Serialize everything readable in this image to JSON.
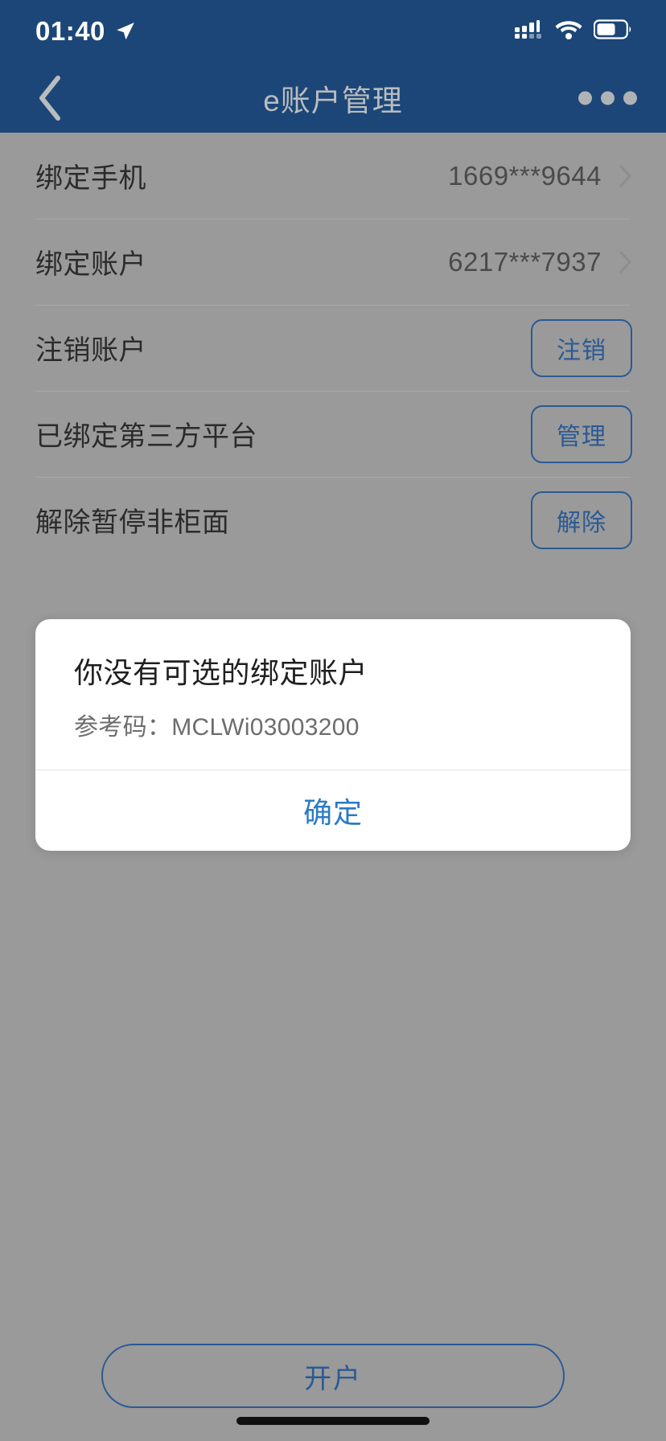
{
  "status_bar": {
    "time": "01:40",
    "location_icon": "location-arrow-icon",
    "signal_icon": "cellular-signal-icon",
    "wifi_icon": "wifi-icon",
    "battery_icon": "battery-icon"
  },
  "nav": {
    "back_icon": "back-chevron-icon",
    "title": "e账户管理",
    "more_icon": "more-dots-icon"
  },
  "rows": [
    {
      "label": "绑定手机",
      "value": "1669***9644",
      "accessory": "chevron",
      "button": ""
    },
    {
      "label": "绑定账户",
      "value": "6217***7937",
      "accessory": "chevron",
      "button": ""
    },
    {
      "label": "注销账户",
      "value": "",
      "accessory": "button",
      "button": "注销"
    },
    {
      "label": "已绑定第三方平台",
      "value": "",
      "accessory": "button",
      "button": "管理"
    },
    {
      "label": "解除暂停非柜面",
      "value": "",
      "accessory": "button",
      "button": "解除"
    }
  ],
  "dialog": {
    "title": "你没有可选的绑定账户",
    "ref_label": "参考码：",
    "ref_code": "MCLWi03003200",
    "ok_label": "确定"
  },
  "bottom": {
    "open_account_label": "开户"
  },
  "colors": {
    "header_blue": "#1c4677",
    "dim_background": "#9a9a9a",
    "accent_blue": "#2a5a94",
    "link_blue": "#2a7ac4",
    "dialog_white": "#ffffff"
  }
}
